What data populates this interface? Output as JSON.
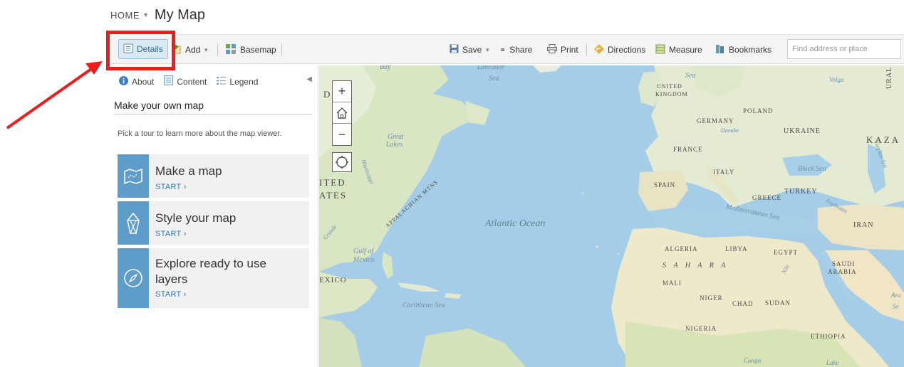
{
  "header": {
    "home": "HOME",
    "title": "My Map"
  },
  "toolbar": {
    "details": "Details",
    "add": "Add",
    "basemap": "Basemap",
    "save": "Save",
    "share": "Share",
    "print": "Print",
    "directions": "Directions",
    "measure": "Measure",
    "bookmarks": "Bookmarks",
    "search_placeholder": "Find address or place"
  },
  "sidebar": {
    "tabs": [
      "About",
      "Content",
      "Legend"
    ],
    "title": "Make your own map",
    "description": "Pick a tour to learn more about the map viewer.",
    "tours": [
      {
        "title": "Make a map",
        "start": "START ›"
      },
      {
        "title": "Style your map",
        "start": "START ›"
      },
      {
        "title_line1": "Explore ready to use",
        "title_line2": "layers",
        "start": "START ›"
      }
    ]
  },
  "map": {
    "labels": {
      "bay": "Bay",
      "labrador": "Labrador",
      "labrador_sea": "Sea",
      "great_lakes_1": "Great",
      "great_lakes_2": "Lakes",
      "appalachian": "APPALACHIAN MTNS",
      "mississippi": "Mississippi",
      "united": "ITED",
      "states": "ATES",
      "d_partial": "D",
      "gulf1": "Gulf of",
      "gulf2": "Mexico",
      "mexico": "EXICO",
      "caribbean": "Caribbean Sea",
      "atlantic": "Atlantic Ocean",
      "north_sea": "Sea",
      "uk1": "UNITED",
      "uk2": "KINGDOM",
      "poland": "POLAND",
      "germany": "GERMANY",
      "ukraine": "UKRAINE",
      "danube": "Danube",
      "kaza": "KAZA",
      "france": "FRANCE",
      "italy": "ITALY",
      "black_sea": "Black Sea",
      "caspian": "Caspian Sea",
      "spain": "SPAIN",
      "greece": "GREECE",
      "turkey": "TURKEY",
      "med": "Mediterranean Sea",
      "iran": "IRAN",
      "algeria": "ALGERIA",
      "libya": "LIBYA",
      "egypt": "EGYPT",
      "saudi1": "SAUDI",
      "saudi2": "ARABIA",
      "sahara": "S A H A R A",
      "mali": "MALI",
      "niger": "NIGER",
      "chad": "CHAD",
      "sudan": "SUDAN",
      "nigeria": "NIGERIA",
      "ethiopia": "ETHIOPIA",
      "congo": "Congo",
      "volga": "Volga",
      "ural": "URAL",
      "euphrates": "Euphrates",
      "nile": "Nile",
      "grande": "Grande",
      "lake": "Lake",
      "ara": "Ara",
      "se": "Se"
    }
  },
  "colors": {
    "highlight": "#ee1c1c",
    "accent": "#5e9dc9",
    "water": "#a5cde8",
    "land": "#d9e6c4"
  }
}
